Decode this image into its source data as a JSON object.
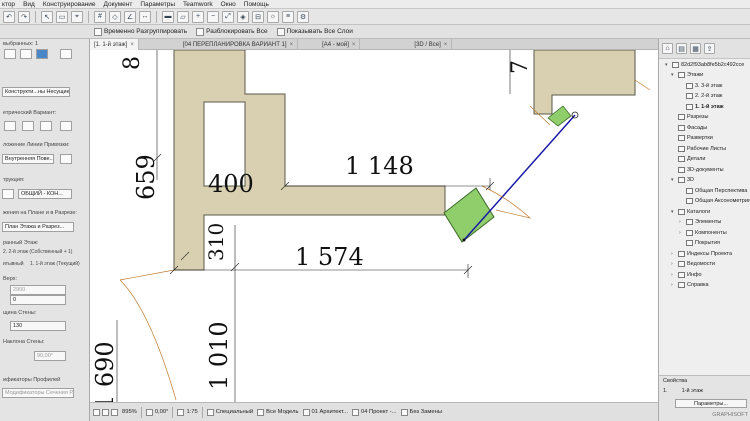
{
  "menubar": [
    "ктор",
    "Вид",
    "Конструирование",
    "Документ",
    "Параметры",
    "Teamwork",
    "Окно",
    "Помощь"
  ],
  "toolbar2": {
    "temp_unlock": "Временно Разгруппировать",
    "unlock_all": "Разблокировать Все",
    "show_all_layers": "Показывать Все Слои"
  },
  "tabs": [
    {
      "label": "[1. 1-й этаж]",
      "active": true
    },
    {
      "label": "[04 ПЕРЕПЛАНИРОВКА ВАРИАНТ 1]",
      "active": false
    },
    {
      "label": "[А4 - мой]",
      "active": false
    },
    {
      "label": "[3D / Все]",
      "active": false
    }
  ],
  "left_panel": {
    "selected": "выбранных: 1",
    "structure": "Конструкти...ны Несущие",
    "geometry": "етрический Вариант:",
    "reference_line": "ложение Линии Привязки:",
    "reference_value": "Внутренняя Пове...",
    "section_label": "трукция:",
    "composite": "ОБЩИЙ - КОН...",
    "show_on_plan": "жения на Плане и в Разрезе:",
    "plan_section": "План Этажа и Разрез...",
    "home_story_label": "ранный Этаж:",
    "home_story": "2. 2-й этаж (Собственный + 1)",
    "top_link": "итывный",
    "top_link_value": "1. 1-й этаж (Текущий)",
    "height_label": "Верх:",
    "height_value": "2900",
    "offset_value": "0",
    "thickness_label": "щина Стены:",
    "thickness_value": "130",
    "slant_label": "Наклона Стены:",
    "slant_value": "90,00°",
    "profile_label": "ификаторы Профилей",
    "profile_value": "Модификаторы Сечения Р..."
  },
  "dimensions": {
    "d659": "659",
    "d400": "400",
    "d1148": "1 148",
    "d310": "310",
    "d1574": "1 574",
    "d1010": "1 010",
    "d1690": "1 690",
    "d_top_left": "8",
    "d_top_right": "7"
  },
  "navigator": {
    "root": "82d2f93ab8fe5b2c492cce",
    "items": [
      {
        "label": "Этажи",
        "level": 1,
        "exp": "▾"
      },
      {
        "label": "3. 3-й этаж",
        "level": 2,
        "exp": ""
      },
      {
        "label": "2. 2-й этаж",
        "level": 2,
        "exp": ""
      },
      {
        "label": "1. 1-й этаж",
        "level": 2,
        "exp": "",
        "selected": true
      },
      {
        "label": "Разрезы",
        "level": 1,
        "exp": ""
      },
      {
        "label": "Фасады",
        "level": 1,
        "exp": ""
      },
      {
        "label": "Развертки",
        "level": 1,
        "exp": ""
      },
      {
        "label": "Рабочие Листы",
        "level": 1,
        "exp": ""
      },
      {
        "label": "Детали",
        "level": 1,
        "exp": ""
      },
      {
        "label": "3D-документы",
        "level": 1,
        "exp": ""
      },
      {
        "label": "3D",
        "level": 1,
        "exp": "▾"
      },
      {
        "label": "Общая Перспектива",
        "level": 2,
        "exp": ""
      },
      {
        "label": "Общая Аксонометрия",
        "level": 2,
        "exp": ""
      },
      {
        "label": "Каталоги",
        "level": 1,
        "exp": "▾"
      },
      {
        "label": "Элементы",
        "level": 2,
        "exp": "›"
      },
      {
        "label": "Компоненты",
        "level": 2,
        "exp": "›"
      },
      {
        "label": "Покрытия",
        "level": 2,
        "exp": ""
      },
      {
        "label": "Индексы Проекта",
        "level": 1,
        "exp": "›"
      },
      {
        "label": "Ведомости",
        "level": 1,
        "exp": "›"
      },
      {
        "label": "Инфо",
        "level": 1,
        "exp": "›"
      },
      {
        "label": "Справка",
        "level": 1,
        "exp": "›"
      }
    ],
    "properties_title": "Свойства",
    "prop_num": "1.",
    "prop_name": "1-й этаж",
    "params_button": "Параметры...",
    "brand": "GRAPHISOFT"
  },
  "statusbar": {
    "zoom": "895%",
    "angle": "0,00°",
    "scale": "1:75",
    "layer_combo": "Специальный",
    "model_view": "Все Модель",
    "pen_set": "01 Архитект...",
    "renovation": "04 Проект -...",
    "graphic_override": "Без Замены"
  }
}
